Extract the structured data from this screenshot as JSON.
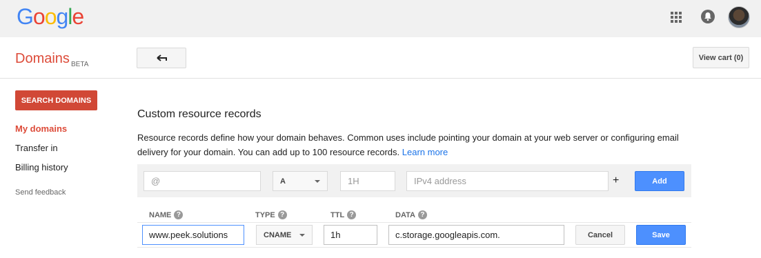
{
  "header": {
    "logo_letters": [
      {
        "char": "G",
        "color": "#4285f4"
      },
      {
        "char": "o",
        "color": "#ea4335"
      },
      {
        "char": "o",
        "color": "#fbbc05"
      },
      {
        "char": "g",
        "color": "#4285f4"
      },
      {
        "char": "l",
        "color": "#34a853"
      },
      {
        "char": "e",
        "color": "#ea4335"
      }
    ],
    "icons": {
      "apps": "apps-grid-icon",
      "notifications": "bell-icon",
      "account": "avatar"
    }
  },
  "subheader": {
    "title": "Domains",
    "badge": "BETA",
    "back_icon": "back-arrow-icon",
    "view_cart_label": "View cart (0)"
  },
  "sidebar": {
    "search_button": "SEARCH DOMAINS",
    "items": [
      {
        "label": "My domains",
        "active": true
      },
      {
        "label": "Transfer in",
        "active": false
      },
      {
        "label": "Billing history",
        "active": false
      }
    ],
    "feedback": "Send feedback"
  },
  "main": {
    "title": "Custom resource records",
    "description": "Resource records define how your domain behaves. Common uses include pointing your domain at your web server or configuring email delivery for your domain. You can add up to 100 resource records.",
    "learn_more": "Learn more",
    "add_row": {
      "name_placeholder": "@",
      "type_value": "A",
      "ttl_placeholder": "1H",
      "data_placeholder": "IPv4 address",
      "plus": "+",
      "add_label": "Add"
    },
    "columns": [
      "NAME",
      "TYPE",
      "TTL",
      "DATA"
    ],
    "edit_row": {
      "name_value": "www.peek.solutions",
      "type_value": "CNAME",
      "ttl_value": "1h",
      "data_value": "c.storage.googleapis.com.",
      "cancel_label": "Cancel",
      "save_label": "Save"
    }
  },
  "colors": {
    "accent_red": "#dd4b39",
    "button_blue": "#4d90fe",
    "link_blue": "#1a73e8"
  }
}
